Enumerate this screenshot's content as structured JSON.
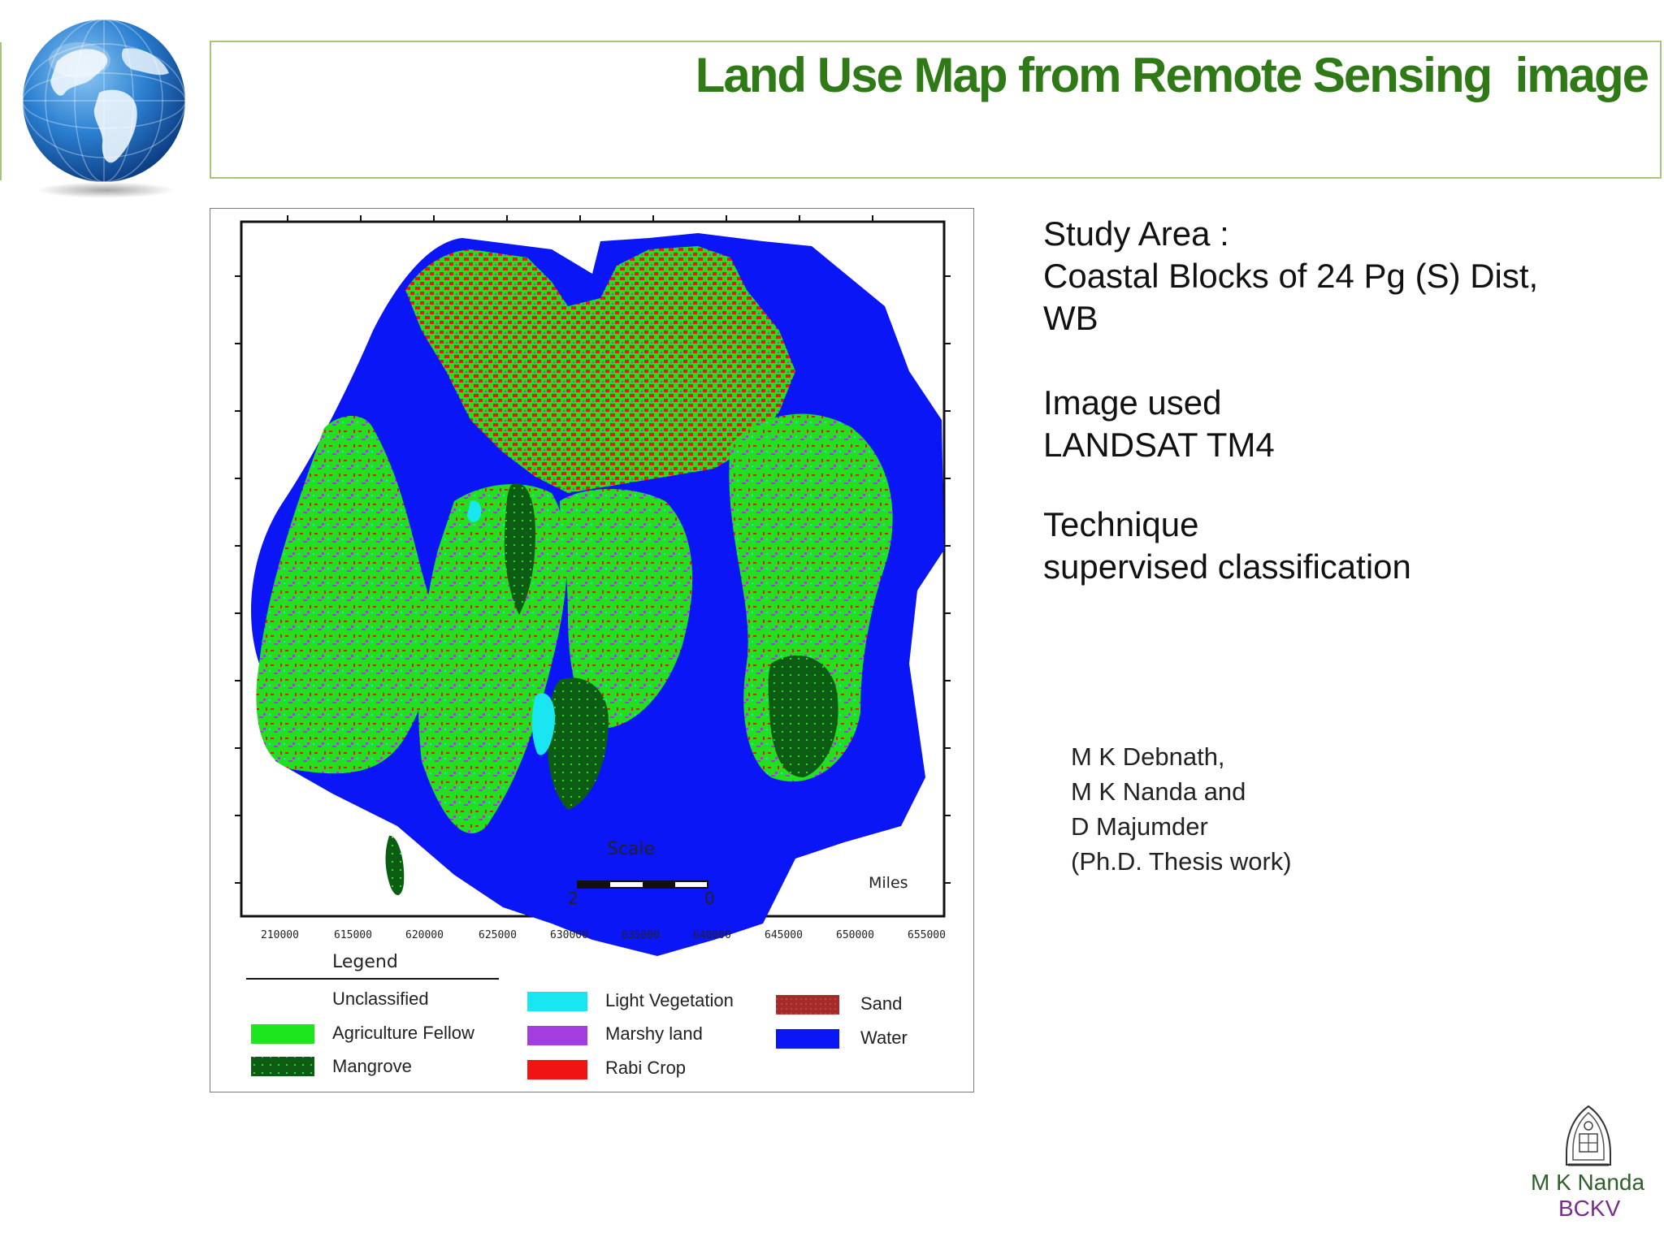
{
  "slide": {
    "title": "Land Use Map from Remote Sensing  image",
    "accent_color": "#2f7a16",
    "frame_color": "#a7c47a"
  },
  "info": {
    "study_area_label": "Study Area :",
    "study_area_line1": "Coastal Blocks of 24 Pg (S) Dist,",
    "study_area_line2": "WB",
    "image_label": "Image used",
    "image_value": "LANDSAT TM4",
    "technique_label": "Technique",
    "technique_value": "supervised classification"
  },
  "credits": {
    "line1": "M K Debnath,",
    "line2": "M K Nanda and",
    "line3": "D Majumder",
    "line4": "(Ph.D. Thesis work)"
  },
  "footer": {
    "name": "M K Nanda",
    "org": "BCKV"
  },
  "map": {
    "scale_title": "Scale",
    "scale_units": "Miles",
    "scale_left": "2",
    "scale_right": "0",
    "x_ticks": [
      "210000",
      "615000",
      "620000",
      "625000",
      "630000",
      "635000",
      "640000",
      "645000",
      "650000",
      "655000"
    ],
    "legend": {
      "title": "Legend",
      "items": [
        {
          "label": "Unclassified",
          "color": "#ffffff"
        },
        {
          "label": "Agriculture Fellow",
          "color": "#1ee61e"
        },
        {
          "label": "Mangrove",
          "color": "#0d5c14"
        },
        {
          "label": "Light Vegetation",
          "color": "#19e6f0"
        },
        {
          "label": "Marshy land",
          "color": "#a23ee0"
        },
        {
          "label": "Rabi Crop",
          "color": "#f01414"
        },
        {
          "label": "Sand",
          "color": "#a52a2a"
        },
        {
          "label": "Water",
          "color": "#0a16f5"
        }
      ]
    }
  }
}
